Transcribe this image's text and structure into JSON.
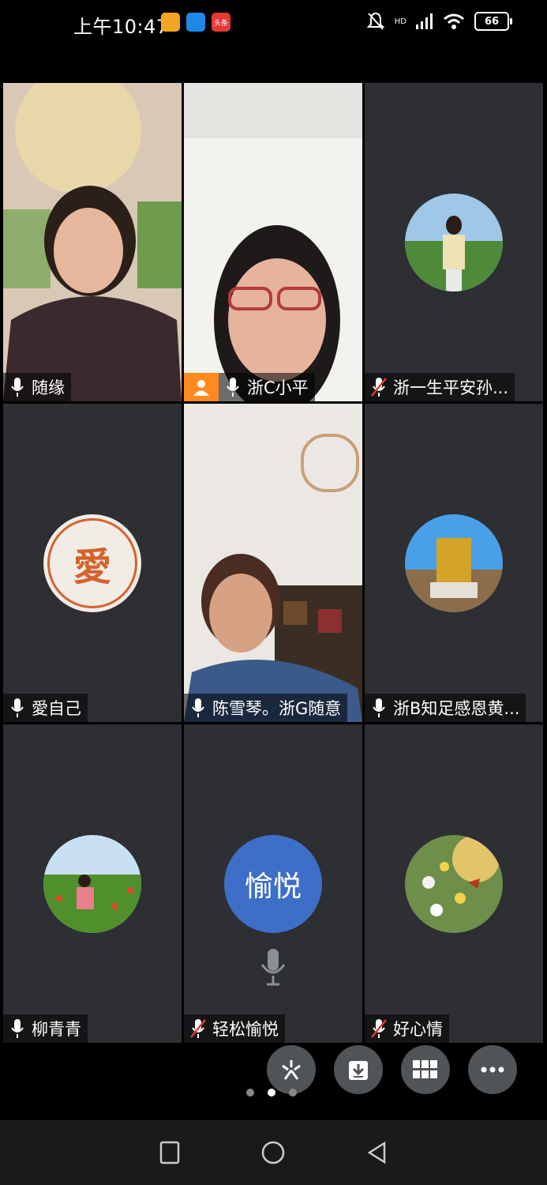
{
  "status_bar": {
    "time": "上午10:47",
    "battery": "66",
    "network": "HD",
    "app_icons": [
      "orange-app-icon",
      "chat-app-icon",
      "toutiao-app-icon"
    ],
    "toutiao_label": "头条"
  },
  "participants": [
    {
      "name": "随缘",
      "mic": "on",
      "video": "on"
    },
    {
      "name": "浙C小平",
      "mic": "on",
      "video": "on",
      "host": true
    },
    {
      "name": "浙一生平安孙...",
      "mic": "muted",
      "video": "off"
    },
    {
      "name": "愛自己",
      "mic": "on",
      "video": "off",
      "avatar_text": "愛"
    },
    {
      "name": "陈雪琴。浙G随意",
      "mic": "on",
      "video": "on",
      "active_speaker": true
    },
    {
      "name": "浙B知足感恩黄...",
      "mic": "on",
      "video": "off"
    },
    {
      "name": "柳青青",
      "mic": "on",
      "video": "off"
    },
    {
      "name": "轻松愉悦",
      "mic": "muted",
      "video": "off",
      "avatar_text": "愉悦"
    },
    {
      "name": "好心情",
      "mic": "muted",
      "video": "off"
    }
  ],
  "controls": [
    "beauty-icon",
    "download-icon",
    "grid-view-icon",
    "more-icon"
  ],
  "pager": {
    "pages": 3,
    "current": 2
  },
  "colors": {
    "tile_bg": "#2d2f33",
    "active_border": "#3fbf6a",
    "host_badge": "#ff8a1f",
    "text_avatar": "#3d6fc9"
  }
}
